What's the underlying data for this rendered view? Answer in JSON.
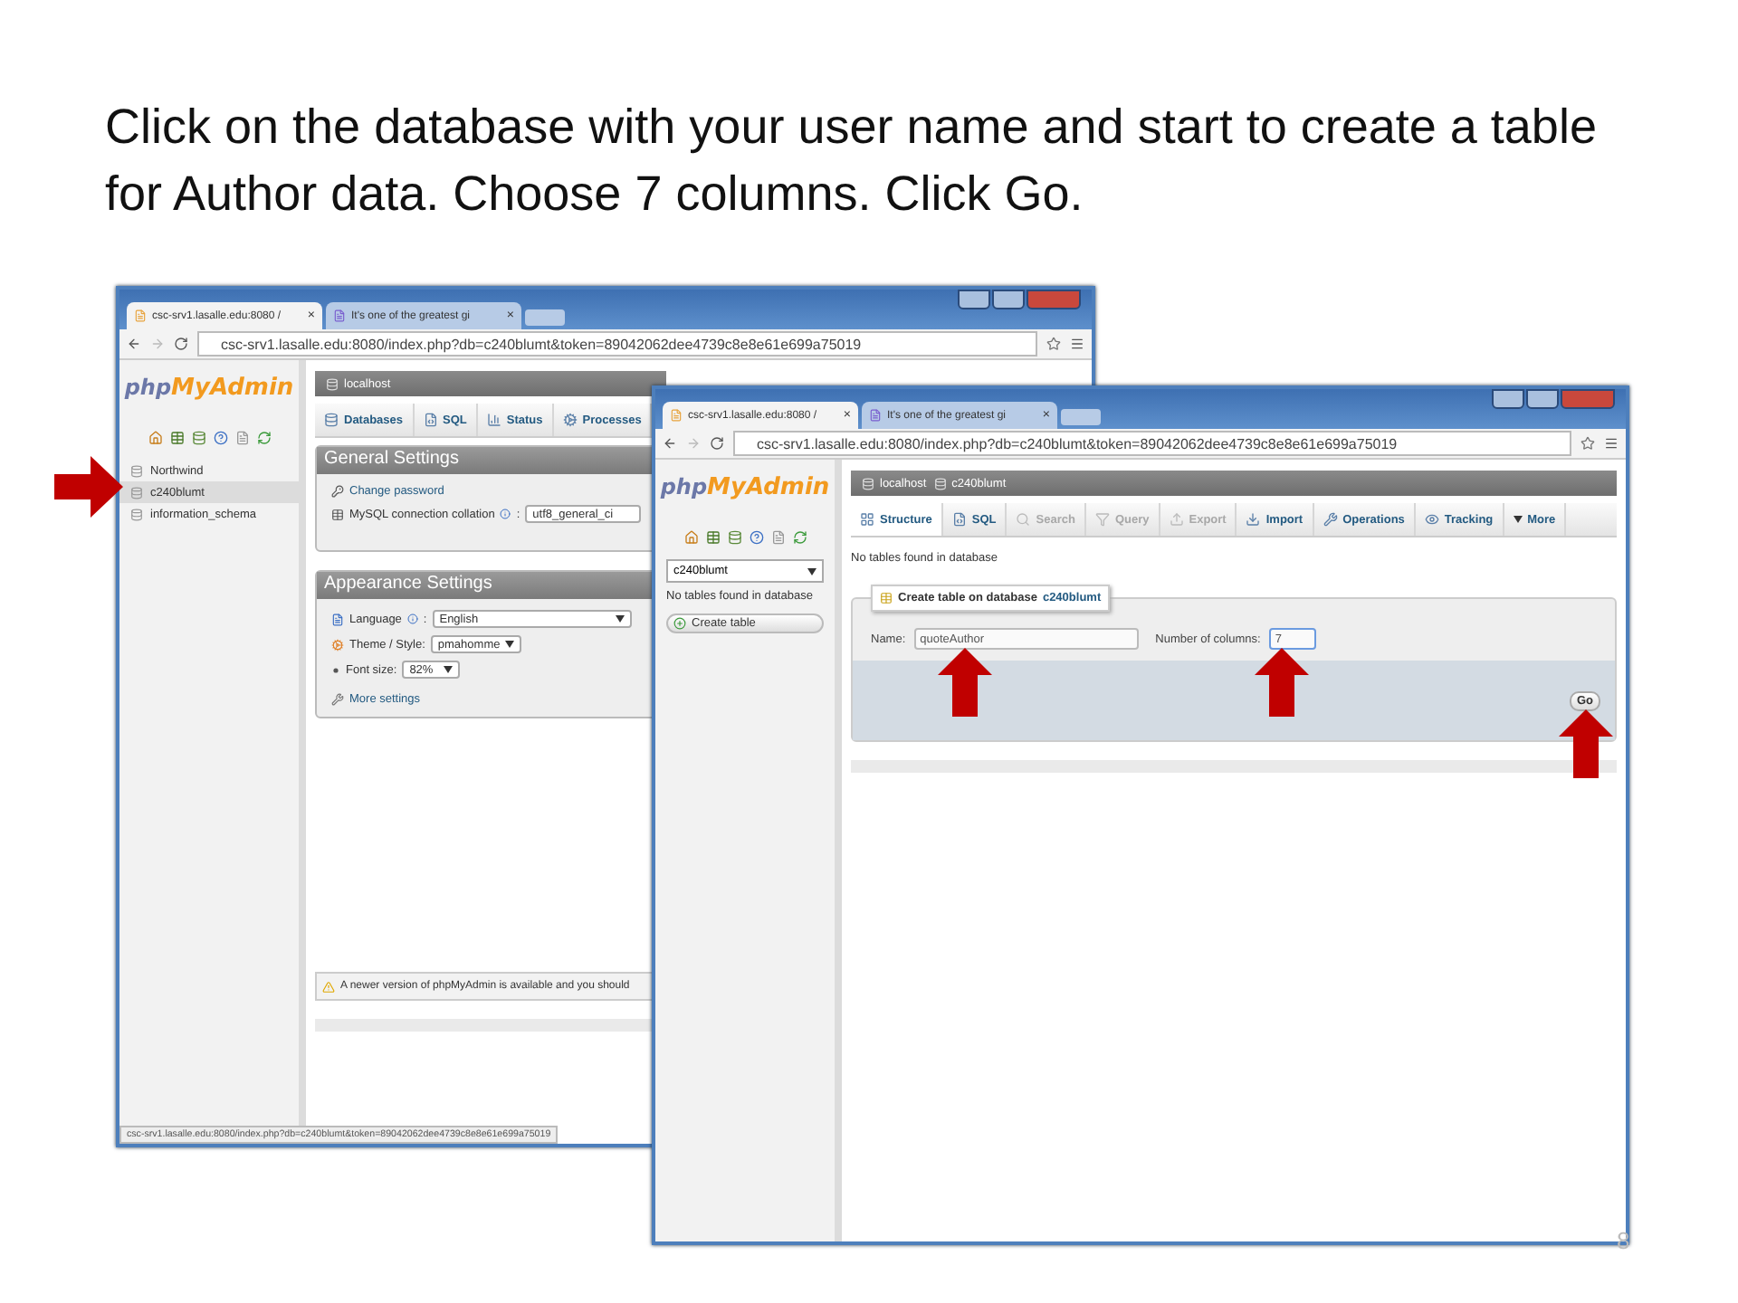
{
  "slide": {
    "instruction": "Click on the database with your user name and start to create a table for Author data. Choose 7 columns. Click Go.",
    "page_number": "8"
  },
  "back_window": {
    "tabs": [
      {
        "title": "csc-srv1.lasalle.edu:8080 /",
        "close": "×",
        "selected": true
      },
      {
        "title": "It's one of the greatest gi",
        "close": "×",
        "selected": false
      }
    ],
    "url": "csc-srv1.lasalle.edu:8080/index.php?db=c240blumt&token=89042062dee4739c8e8e61e699a75019",
    "status_url": "csc-srv1.lasalle.edu:8080/index.php?db=c240blumt&token=89042062dee4739c8e8e61e699a75019",
    "logo": {
      "prefix": "php",
      "main": "MyAdmin"
    },
    "databases": [
      {
        "name": "Northwind",
        "selected": false
      },
      {
        "name": "c240blumt",
        "selected": true
      },
      {
        "name": "information_schema",
        "selected": false
      }
    ],
    "breadcrumb": [
      "localhost"
    ],
    "nav_tabs": [
      {
        "label": "Databases",
        "kind": "database",
        "selected": false,
        "disabled": false
      },
      {
        "label": "SQL",
        "kind": "sql",
        "selected": false,
        "disabled": false
      },
      {
        "label": "Status",
        "kind": "status",
        "selected": false,
        "disabled": false
      },
      {
        "label": "Processes",
        "kind": "processes",
        "selected": false,
        "disabled": false
      }
    ],
    "general_settings": {
      "title": "General Settings",
      "link": "Change password",
      "collation_label": "MySQL connection collation",
      "separator": ":",
      "collation": "utf8_general_ci"
    },
    "appearance_settings": {
      "title": "Appearance Settings",
      "rows": [
        {
          "kind": "language",
          "label": "Language",
          "separator": ":",
          "value": "English"
        },
        {
          "kind": "theme",
          "label": "Theme / Style:",
          "value": "pmahomme"
        },
        {
          "kind": "font",
          "label": "Font size:",
          "value": "82%"
        }
      ],
      "link": "More settings"
    },
    "notice": "A newer version of phpMyAdmin is available and you should"
  },
  "front_window": {
    "tabs": [
      {
        "title": "csc-srv1.lasalle.edu:8080 /",
        "close": "×",
        "selected": true
      },
      {
        "title": "It's one of the greatest gi",
        "close": "×",
        "selected": false
      }
    ],
    "url": "csc-srv1.lasalle.edu:8080/index.php?db=c240blumt&token=89042062dee4739c8e8e61e699a75019",
    "logo": {
      "prefix": "php",
      "main": "MyAdmin"
    },
    "database_select": "c240blumt",
    "sidebar_note": "No tables found in database",
    "create_button": "Create table",
    "breadcrumb": [
      "localhost",
      "c240blumt"
    ],
    "nav_tabs": [
      {
        "label": "Structure",
        "kind": "structure",
        "selected": true,
        "disabled": false
      },
      {
        "label": "SQL",
        "kind": "sql",
        "selected": false,
        "disabled": false
      },
      {
        "label": "Search",
        "kind": "search",
        "selected": false,
        "disabled": true
      },
      {
        "label": "Query",
        "kind": "query",
        "selected": false,
        "disabled": true
      },
      {
        "label": "Export",
        "kind": "export",
        "selected": false,
        "disabled": true
      },
      {
        "label": "Import",
        "kind": "import",
        "selected": false,
        "disabled": false
      },
      {
        "label": "Operations",
        "kind": "operations",
        "selected": false,
        "disabled": false
      },
      {
        "label": "Tracking",
        "kind": "tracking",
        "selected": false,
        "disabled": false
      },
      {
        "label": "More",
        "kind": "more",
        "selected": false,
        "disabled": false
      }
    ],
    "message": "No tables found in database",
    "create_form": {
      "legend": "Create table on database",
      "database": "c240blumt",
      "name_label": "Name:",
      "name_value": "quoteAuthor",
      "columns_label": "Number of columns:",
      "columns_value": "7",
      "go": "Go"
    }
  },
  "arrows": [
    {
      "kind": "right"
    },
    {
      "kind": "up"
    },
    {
      "kind": "up"
    },
    {
      "kind": "up"
    }
  ]
}
